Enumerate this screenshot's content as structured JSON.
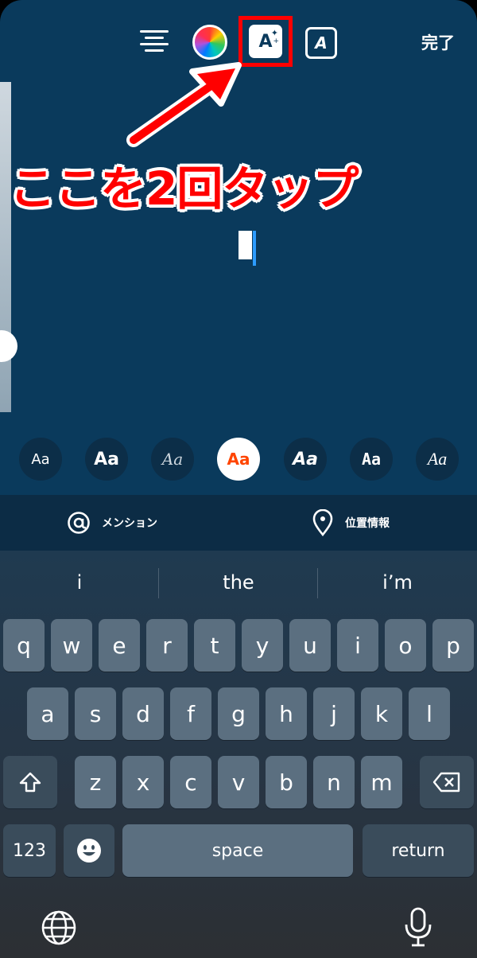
{
  "toolbar": {
    "align_icon": "text-align-center-icon",
    "color_icon": "color-wheel-icon",
    "effect_icon": "text-effect-sparkle-icon",
    "effect_letter": "A",
    "animation_icon": "text-animation-icon",
    "animation_letter": "A",
    "done_label": "完了"
  },
  "annotation": {
    "text": "ここを2回タップ",
    "color": "#ff0000"
  },
  "fonts": [
    {
      "label": "Aa",
      "icon": "font-classic"
    },
    {
      "label": "Aa",
      "icon": "font-modern"
    },
    {
      "label": "Aa",
      "icon": "font-script"
    },
    {
      "label": "Aa",
      "icon": "font-neon",
      "active": true
    },
    {
      "label": "Aa",
      "icon": "font-strong"
    },
    {
      "label": "Aa",
      "icon": "font-typewriter"
    },
    {
      "label": "Aa",
      "icon": "font-serif"
    }
  ],
  "mention_bar": {
    "mention_label": "メンション",
    "mention_icon": "at-sign-icon",
    "location_label": "位置情報",
    "location_icon": "location-pin-icon"
  },
  "keyboard": {
    "suggestions": [
      "i",
      "the",
      "i’m"
    ],
    "row1": [
      "q",
      "w",
      "e",
      "r",
      "t",
      "y",
      "u",
      "i",
      "o",
      "p"
    ],
    "row2": [
      "a",
      "s",
      "d",
      "f",
      "g",
      "h",
      "j",
      "k",
      "l"
    ],
    "row3": [
      "z",
      "x",
      "c",
      "v",
      "b",
      "n",
      "m"
    ],
    "numbers_label": "123",
    "space_label": "space",
    "return_label": "return",
    "emoji_icon": "emoji-icon",
    "shift_icon": "shift-icon",
    "delete_icon": "backspace-icon",
    "globe_icon": "globe-icon",
    "mic_icon": "microphone-icon"
  },
  "colors": {
    "editor_bg": "#0a3a5c",
    "highlight": "#ff0000",
    "cursor": "#2d9cff"
  }
}
